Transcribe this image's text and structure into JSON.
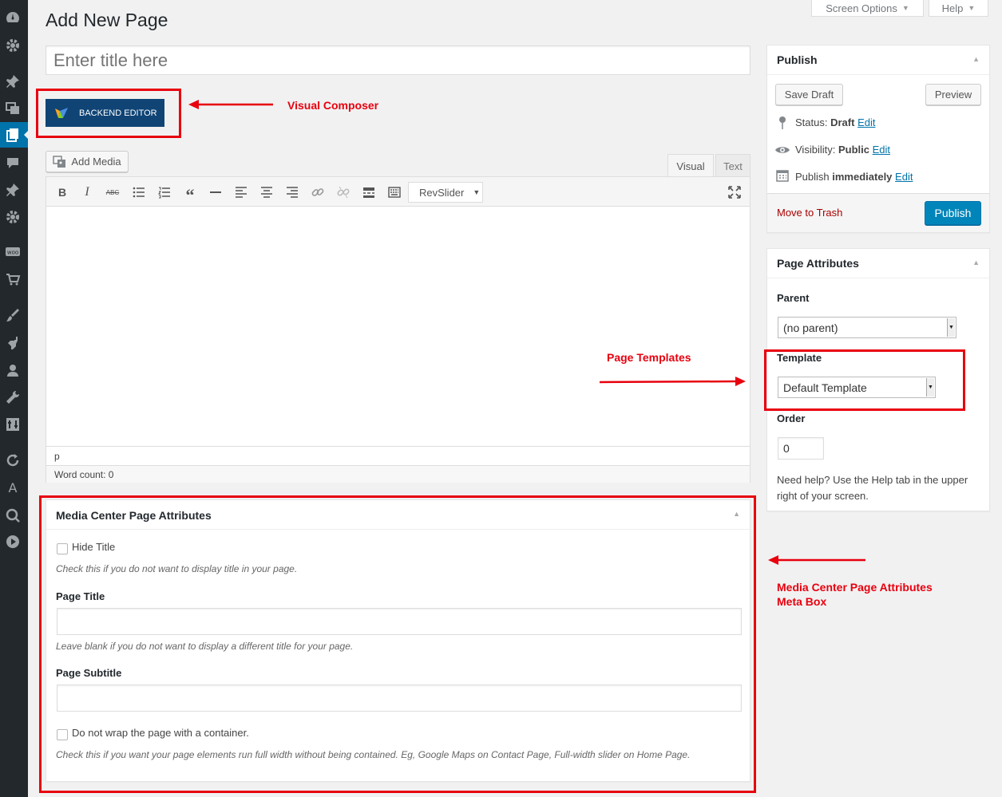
{
  "sidebar": {
    "icons": [
      "dashboard-icon",
      "gear-icon",
      "pin-icon",
      "media-icon",
      "pages-icon",
      "comments-icon",
      "pin-icon",
      "gear-icon",
      "woo-icon",
      "cart-icon",
      "brush-icon",
      "plugin-icon",
      "users-icon",
      "tools-icon",
      "settings-icon",
      "refresh-icon",
      "font-icon",
      "search-icon",
      "play-icon"
    ]
  },
  "top_tabs": {
    "screen_options": "Screen Options",
    "help": "Help"
  },
  "page": {
    "title": "Add New Page",
    "title_placeholder": "Enter title here"
  },
  "composer": {
    "backend_editor": "BACKEND EDITOR"
  },
  "annotations": {
    "visual_composer": "Visual Composer",
    "page_templates": "Page Templates",
    "meta_box_line1": "Media Center Page Attributes",
    "meta_box_line2": "Meta Box",
    "color": "#e8000e"
  },
  "editor": {
    "add_media": "Add Media",
    "tab_visual": "Visual",
    "tab_text": "Text",
    "revslider": "RevSlider",
    "path": "p",
    "word_count": "Word count: 0"
  },
  "publish": {
    "heading": "Publish",
    "save_draft": "Save Draft",
    "preview": "Preview",
    "status_label": "Status:",
    "status_value": "Draft",
    "visibility_label": "Visibility:",
    "visibility_value": "Public",
    "publish_label": "Publish",
    "publish_value": "immediately",
    "edit": "Edit",
    "move_to_trash": "Move to Trash",
    "publish_button": "Publish",
    "button_color": "#0085ba"
  },
  "page_attributes": {
    "heading": "Page Attributes",
    "parent_label": "Parent",
    "parent_value": "(no parent)",
    "template_label": "Template",
    "template_value": "Default Template",
    "order_label": "Order",
    "order_value": "0",
    "help_line1": "Need help? Use the Help tab in the upper",
    "help_line2": "right of your screen."
  },
  "media_center": {
    "heading": "Media Center Page Attributes",
    "hide_title": "Hide Title",
    "hide_title_hint": "Check this if you do not want to display title in your page.",
    "page_title_label": "Page Title",
    "page_title_hint": "Leave blank if you do not want to display a different title for your page.",
    "page_subtitle_label": "Page Subtitle",
    "no_container": "Do not wrap the page with a container.",
    "no_container_hint": "Check this if you want your page elements run full width without being contained. Eg, Google Maps on Contact Page, Full-width slider on Home Page."
  }
}
